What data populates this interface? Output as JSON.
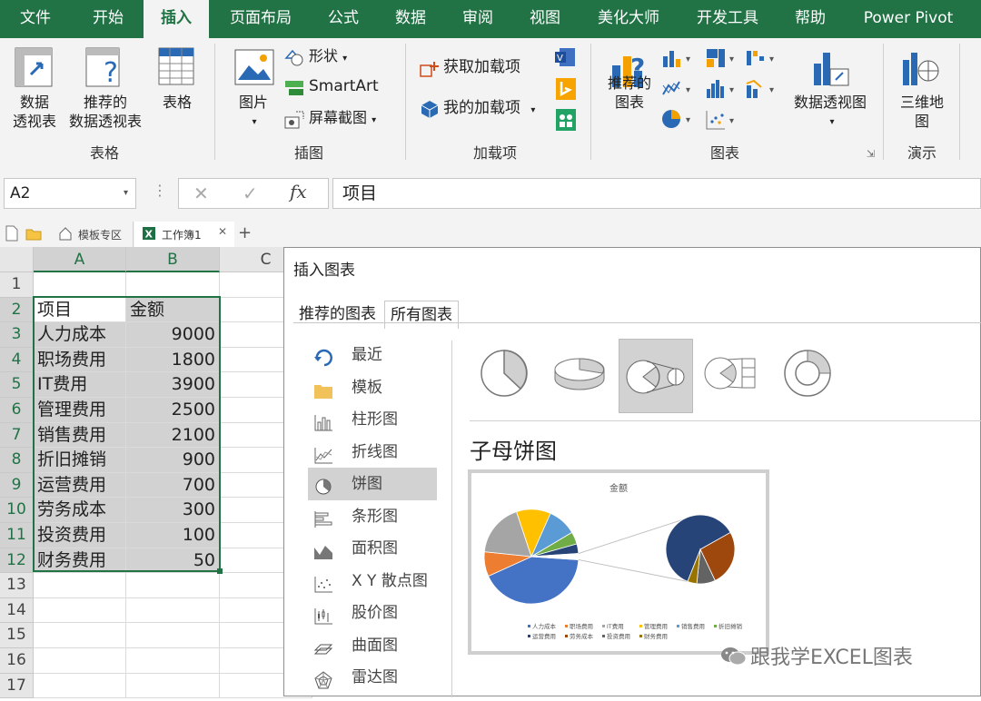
{
  "ribbon_tabs": [
    "文件",
    "开始",
    "插入",
    "页面布局",
    "公式",
    "数据",
    "审阅",
    "视图",
    "美化大师",
    "开发工具",
    "帮助",
    "Power Pivot"
  ],
  "active_tab": "插入",
  "ribbon": {
    "tables": {
      "pivot_line1": "数据",
      "pivot_line2": "透视表",
      "rec_pivot_line1": "推荐的",
      "rec_pivot_line2": "数据透视表",
      "table": "表格",
      "group": "表格"
    },
    "illustrations": {
      "picture": "图片",
      "shapes": "形状",
      "smartart": "SmartArt",
      "screenshot": "屏幕截图",
      "group": "插图"
    },
    "addins": {
      "get": "获取加载项",
      "my": "我的加载项",
      "group": "加载项"
    },
    "charts": {
      "rec_line1": "推荐的",
      "rec_line2": "图表",
      "pivot_chart": "数据透视图",
      "group": "图表"
    },
    "tours": {
      "map_line1": "三维地",
      "map_line2": "图",
      "group": "演示"
    }
  },
  "name_box": "A2",
  "formula_value": "项目",
  "doc_tabs": {
    "template": "模板专区",
    "workbook": "工作簿1",
    "add": "+"
  },
  "sheet": {
    "columns": [
      "A",
      "B",
      "C"
    ],
    "row_numbers": [
      "1",
      "2",
      "3",
      "4",
      "5",
      "6",
      "7",
      "8",
      "9",
      "10",
      "11",
      "12",
      "13",
      "14",
      "15",
      "16",
      "17"
    ],
    "header": [
      "项目",
      "金额"
    ],
    "rows": [
      [
        "人力成本",
        "9000"
      ],
      [
        "职场费用",
        "1800"
      ],
      [
        "IT费用",
        "3900"
      ],
      [
        "管理费用",
        "2500"
      ],
      [
        "销售费用",
        "2100"
      ],
      [
        "折旧摊销",
        "900"
      ],
      [
        "运营费用",
        "700"
      ],
      [
        "劳务成本",
        "300"
      ],
      [
        "投资费用",
        "100"
      ],
      [
        "财务费用",
        "50"
      ]
    ]
  },
  "dialog": {
    "title": "插入图表",
    "tabs": [
      "推荐的图表",
      "所有图表"
    ],
    "active_tab": "所有图表",
    "nav": [
      "最近",
      "模板",
      "柱形图",
      "折线图",
      "饼图",
      "条形图",
      "面积图",
      "X Y 散点图",
      "股价图",
      "曲面图",
      "雷达图"
    ],
    "active_nav": "饼图",
    "selected_subtype": "子母饼图",
    "preview_title": "金额",
    "legend": [
      "人力成本",
      "职场费用",
      "IT费用",
      "管理费用",
      "销售费用",
      "折旧摊销",
      "运营费用",
      "劳务成本",
      "投资费用",
      "财务费用"
    ],
    "colors": [
      "#4472C4",
      "#ED7D31",
      "#A5A5A5",
      "#FFC000",
      "#5B9BD5",
      "#70AD47",
      "#264478",
      "#9E480E",
      "#636363",
      "#997300"
    ]
  },
  "watermark": "跟我学EXCEL图表"
}
